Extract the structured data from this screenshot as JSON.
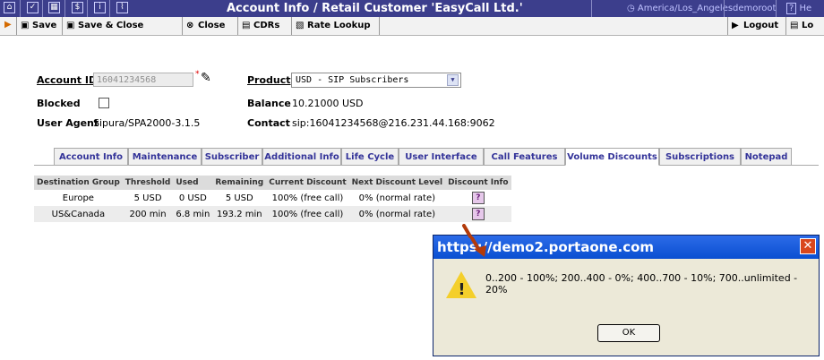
{
  "topbar": {
    "title": "Account Info / Retail Customer 'EasyCall Ltd.'",
    "timezone": "America/Los_Angeles",
    "user": "demoroot",
    "help": "He",
    "icons": [
      "home-icon",
      "checkbox-icon",
      "grid-icon",
      "dollar-icon",
      "info-icon",
      "chart-icon"
    ]
  },
  "toolbar": {
    "save": "Save",
    "save_close": "Save & Close",
    "close": "Close",
    "cdrs": "CDRs",
    "rate_lookup": "Rate Lookup",
    "logout": "Logout",
    "log": "Lo"
  },
  "form": {
    "account_id_label": "Account ID",
    "account_id_value": "16041234568",
    "product_label": "Product",
    "product_value": "USD - SIP Subscribers",
    "blocked_label": "Blocked",
    "balance_label": "Balance",
    "balance_value": "10.21000 USD",
    "user_agent_label": "User Agent",
    "user_agent_value": "Sipura/SPA2000-3.1.5",
    "contact_label": "Contact",
    "contact_value": "sip:16041234568@216.231.44.168:9062"
  },
  "tabs": [
    "Account Info",
    "Maintenance",
    "Subscriber",
    "Additional Info",
    "Life Cycle",
    "User Interface",
    "Call Features",
    "Volume Discounts",
    "Subscriptions",
    "Notepad"
  ],
  "active_tab": "Volume Discounts",
  "table": {
    "headers": [
      "Destination Group",
      "Threshold",
      "Used",
      "Remaining",
      "Current Discount",
      "Next Discount Level",
      "Discount Info"
    ],
    "rows": [
      [
        "Europe",
        "5 USD",
        "0 USD",
        "5 USD",
        "100% (free call)",
        "0% (normal rate)",
        "?"
      ],
      [
        "US&Canada",
        "200 min",
        "6.8 min",
        "193.2 min",
        "100% (free call)",
        "0% (normal rate)",
        "?"
      ]
    ]
  },
  "dialog": {
    "title": "https://demo2.portaone.com",
    "message": "0..200 - 100%; 200..400 - 0%; 400..700 - 10%; 700..unlimited - 20%",
    "ok": "OK"
  },
  "colors": {
    "topbar": "#3c3e8c",
    "tab_text": "#333399",
    "dialog_title": "#0a4fd1",
    "arrow": "#b23a0a"
  }
}
